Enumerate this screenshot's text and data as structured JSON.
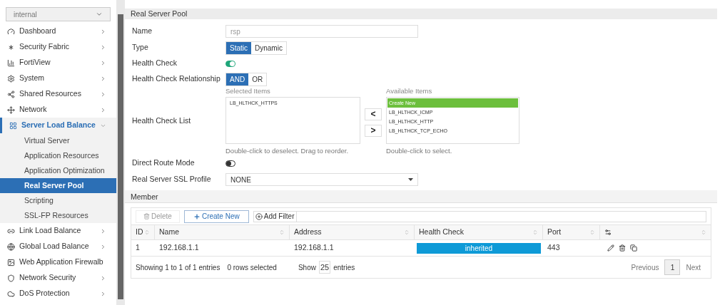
{
  "sidebar": {
    "vdom": "internal",
    "items": [
      {
        "label": "Dashboard",
        "expanded": false,
        "chevron_shown": true,
        "selected": false
      },
      {
        "label": "Security Fabric",
        "expanded": false,
        "chevron_shown": true,
        "selected": false
      },
      {
        "label": "FortiView",
        "expanded": false,
        "chevron_shown": true,
        "selected": false
      },
      {
        "label": "System",
        "expanded": false,
        "chevron_shown": true,
        "selected": false
      },
      {
        "label": "Shared Resources",
        "expanded": false,
        "chevron_shown": true,
        "selected": false
      },
      {
        "label": "Network",
        "expanded": false,
        "chevron_shown": true,
        "selected": false
      },
      {
        "label": "Server Load Balance",
        "expanded": true,
        "chevron_shown": true,
        "selected": true,
        "children": [
          {
            "label": "Virtual Server",
            "selected": false
          },
          {
            "label": "Application Resources",
            "selected": false
          },
          {
            "label": "Application Optimization",
            "selected": false
          },
          {
            "label": "Real Server Pool",
            "selected": true
          },
          {
            "label": "Scripting",
            "selected": false
          },
          {
            "label": "SSL-FP Resources",
            "selected": false
          }
        ]
      },
      {
        "label": "Link Load Balance",
        "expanded": false,
        "chevron_shown": true,
        "selected": false
      },
      {
        "label": "Global Load Balance",
        "expanded": false,
        "chevron_shown": true,
        "selected": false
      },
      {
        "label": "Web Application Firewalb",
        "expanded": false,
        "chevron_shown": false,
        "selected": false
      },
      {
        "label": "Network Security",
        "expanded": false,
        "chevron_shown": true,
        "selected": false
      },
      {
        "label": "DoS Protection",
        "expanded": false,
        "chevron_shown": true,
        "selected": false
      }
    ]
  },
  "form": {
    "title": "Real Server Pool",
    "name": {
      "label": "Name",
      "value": "rsp"
    },
    "type": {
      "label": "Type",
      "options": [
        {
          "label": "Static",
          "selected": true
        },
        {
          "label": "Dynamic",
          "selected": false
        }
      ]
    },
    "health_check": {
      "label": "Health Check",
      "on": true
    },
    "relationship": {
      "label": "Health Check Relationship",
      "options": [
        {
          "label": "AND",
          "selected": true
        },
        {
          "label": "OR",
          "selected": false
        }
      ]
    },
    "health_check_list": {
      "label": "Health Check List",
      "selected_title": "Selected Items",
      "selected_items": [
        "LB_HLTHCK_HTTPS"
      ],
      "selected_hint": "Double-click to deselect. Drag to reorder.",
      "left_arrow": "<",
      "right_arrow": ">",
      "available_title": "Available Items",
      "available_items": [
        {
          "label": "Create New",
          "selected": true
        },
        {
          "label": "LB_HLTHCK_ICMP",
          "selected": false
        },
        {
          "label": "LB_HLTHCK_HTTP",
          "selected": false
        },
        {
          "label": "LB_HLTHCK_TCP_ECHO",
          "selected": false
        }
      ],
      "available_hint": "Double-click to select."
    },
    "direct_route": {
      "label": "Direct Route Mode",
      "on": false
    },
    "ssl_profile": {
      "label": "Real Server SSL Profile",
      "value": "NONE"
    }
  },
  "member": {
    "title": "Member",
    "toolbar": {
      "delete": "Delete",
      "create": "Create New",
      "filter": "Add Filter"
    },
    "columns": [
      "ID",
      "Name",
      "Address",
      "Health Check",
      "Port"
    ],
    "rows": [
      {
        "id": "1",
        "name": "192.168.1.1",
        "address": "192.168.1.1",
        "health_check": "inherited",
        "port": "443"
      }
    ],
    "summary": "Showing 1 to 1 of 1 entries",
    "rows_selected": "0 rows selected",
    "show": "Show",
    "page_size": "25",
    "entries": "entries",
    "pagination": {
      "previous": "Previous",
      "pages": [
        {
          "label": "1",
          "selected": true
        }
      ],
      "next": "Next"
    }
  }
}
